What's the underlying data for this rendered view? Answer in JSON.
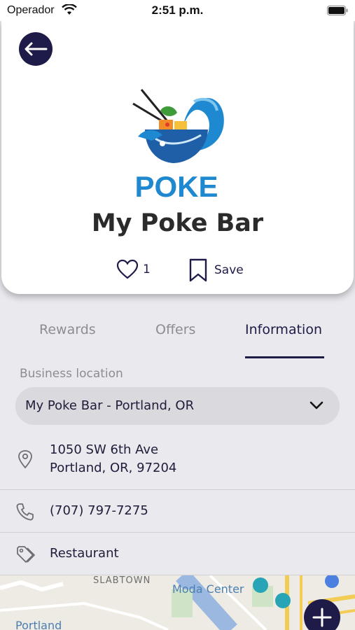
{
  "status_bar": {
    "carrier": "Operador",
    "time": "2:51 p.m."
  },
  "header": {
    "logo_text": "POKE",
    "business_name": "My Poke Bar",
    "like_count": "1",
    "save_label": "Save"
  },
  "tabs": [
    {
      "label": "Rewards",
      "selected": false
    },
    {
      "label": "Offers",
      "selected": false
    },
    {
      "label": "Information",
      "selected": true
    }
  ],
  "info": {
    "location_label": "Business location",
    "location_value": "My Poke Bar - Portland, OR",
    "address_line1": "1050 SW 6th Ave",
    "address_line2": "Portland, OR, 97204",
    "phone": "(707) 797-7275",
    "category": "Restaurant"
  },
  "map": {
    "labels": [
      "SLABTOWN",
      "Moda Center",
      "Portland"
    ]
  },
  "colors": {
    "primary": "#1e1b48",
    "background": "#e9e9ee",
    "logo_blue": "#1e88d0"
  },
  "icons": [
    "wifi-icon",
    "battery-icon",
    "arrow-left-icon",
    "heart-icon",
    "bookmark-icon",
    "chevron-down-icon",
    "map-pin-icon",
    "phone-icon",
    "tag-icon",
    "plus-icon"
  ]
}
